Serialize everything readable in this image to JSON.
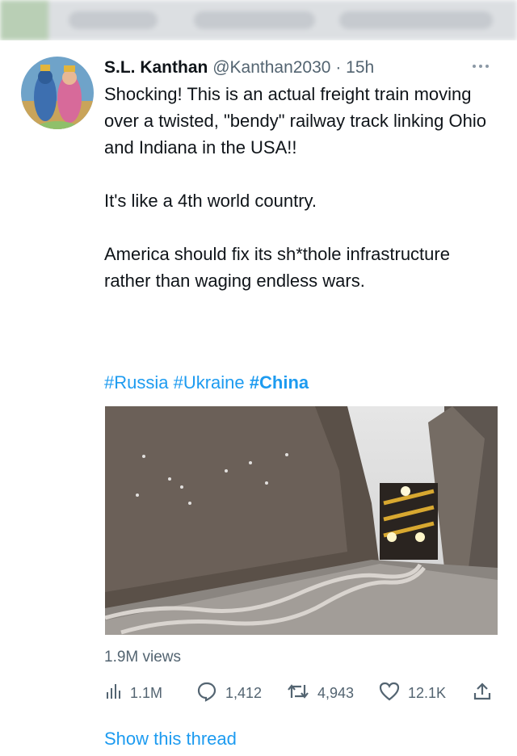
{
  "tweet": {
    "author_name": "S.L. Kanthan",
    "handle": "@Kanthan2030",
    "separator": "·",
    "time": "15h",
    "more_icon": "more-icon",
    "text_lines": [
      "Shocking! This is an actual freight train moving over a twisted, \"bendy\" railway track linking Ohio and Indiana in the USA!!",
      "It's like a 4th world country.",
      "America should fix its sh*thole infrastructure rather than waging endless wars."
    ],
    "hashtags": [
      "#Russia",
      "#Ukraine",
      "#China"
    ],
    "views": "1.9M views",
    "actions": {
      "analytics": "1.1M",
      "replies": "1,412",
      "retweets": "4,943",
      "likes": "12.1K"
    },
    "show_thread": "Show this thread"
  },
  "colors": {
    "link": "#1d9bf0",
    "secondary_text": "#536471",
    "primary_text": "#0f1419"
  }
}
